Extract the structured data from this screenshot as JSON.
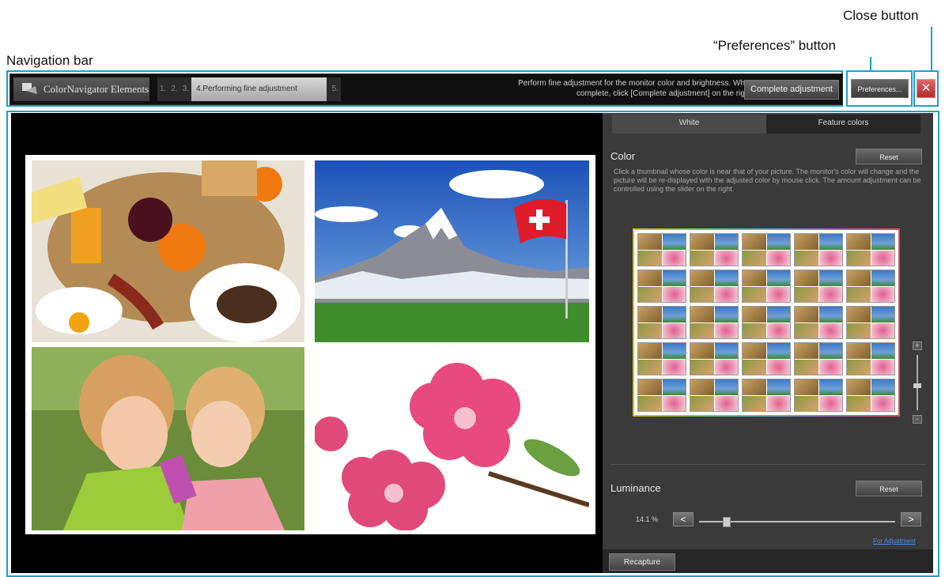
{
  "annotations": {
    "close": "Close button",
    "preferences": "“Preferences” button",
    "navbar": "Navigation bar"
  },
  "navbar": {
    "app_name": "ColorNavigator Elements",
    "steps": [
      "1.",
      "2.",
      "3.",
      "4.Performing fine adjustment",
      "5."
    ],
    "message": "Perform fine adjustment for the monitor color and brightness. When complete, click [Complete adjustment] on the right.",
    "complete_label": "Complete adjustment",
    "preferences_label": "Preferences...",
    "close_glyph": "✕"
  },
  "panel": {
    "tabs": [
      "White",
      "Feature colors"
    ],
    "color_title": "Color",
    "reset_label": "Reset",
    "color_desc": "Click a thumbnail whose color is near that of your picture. The monitor's color will change and the picture will be re-displayed with the adjusted color by mouse click. The amount adjustment can be controlled using the slider on the right.",
    "slider_plus": "+",
    "slider_minus": "-",
    "luminance_title": "Luminance",
    "luminance_value": "14.1 %",
    "left_arrow": "<",
    "right_arrow": ">",
    "link_label": "For Adjustment",
    "recapture_label": "Recapture"
  },
  "colors": {
    "accent": "#1aa0d8",
    "close_red": "#c03a3a",
    "link_blue": "#4b8ee8"
  }
}
